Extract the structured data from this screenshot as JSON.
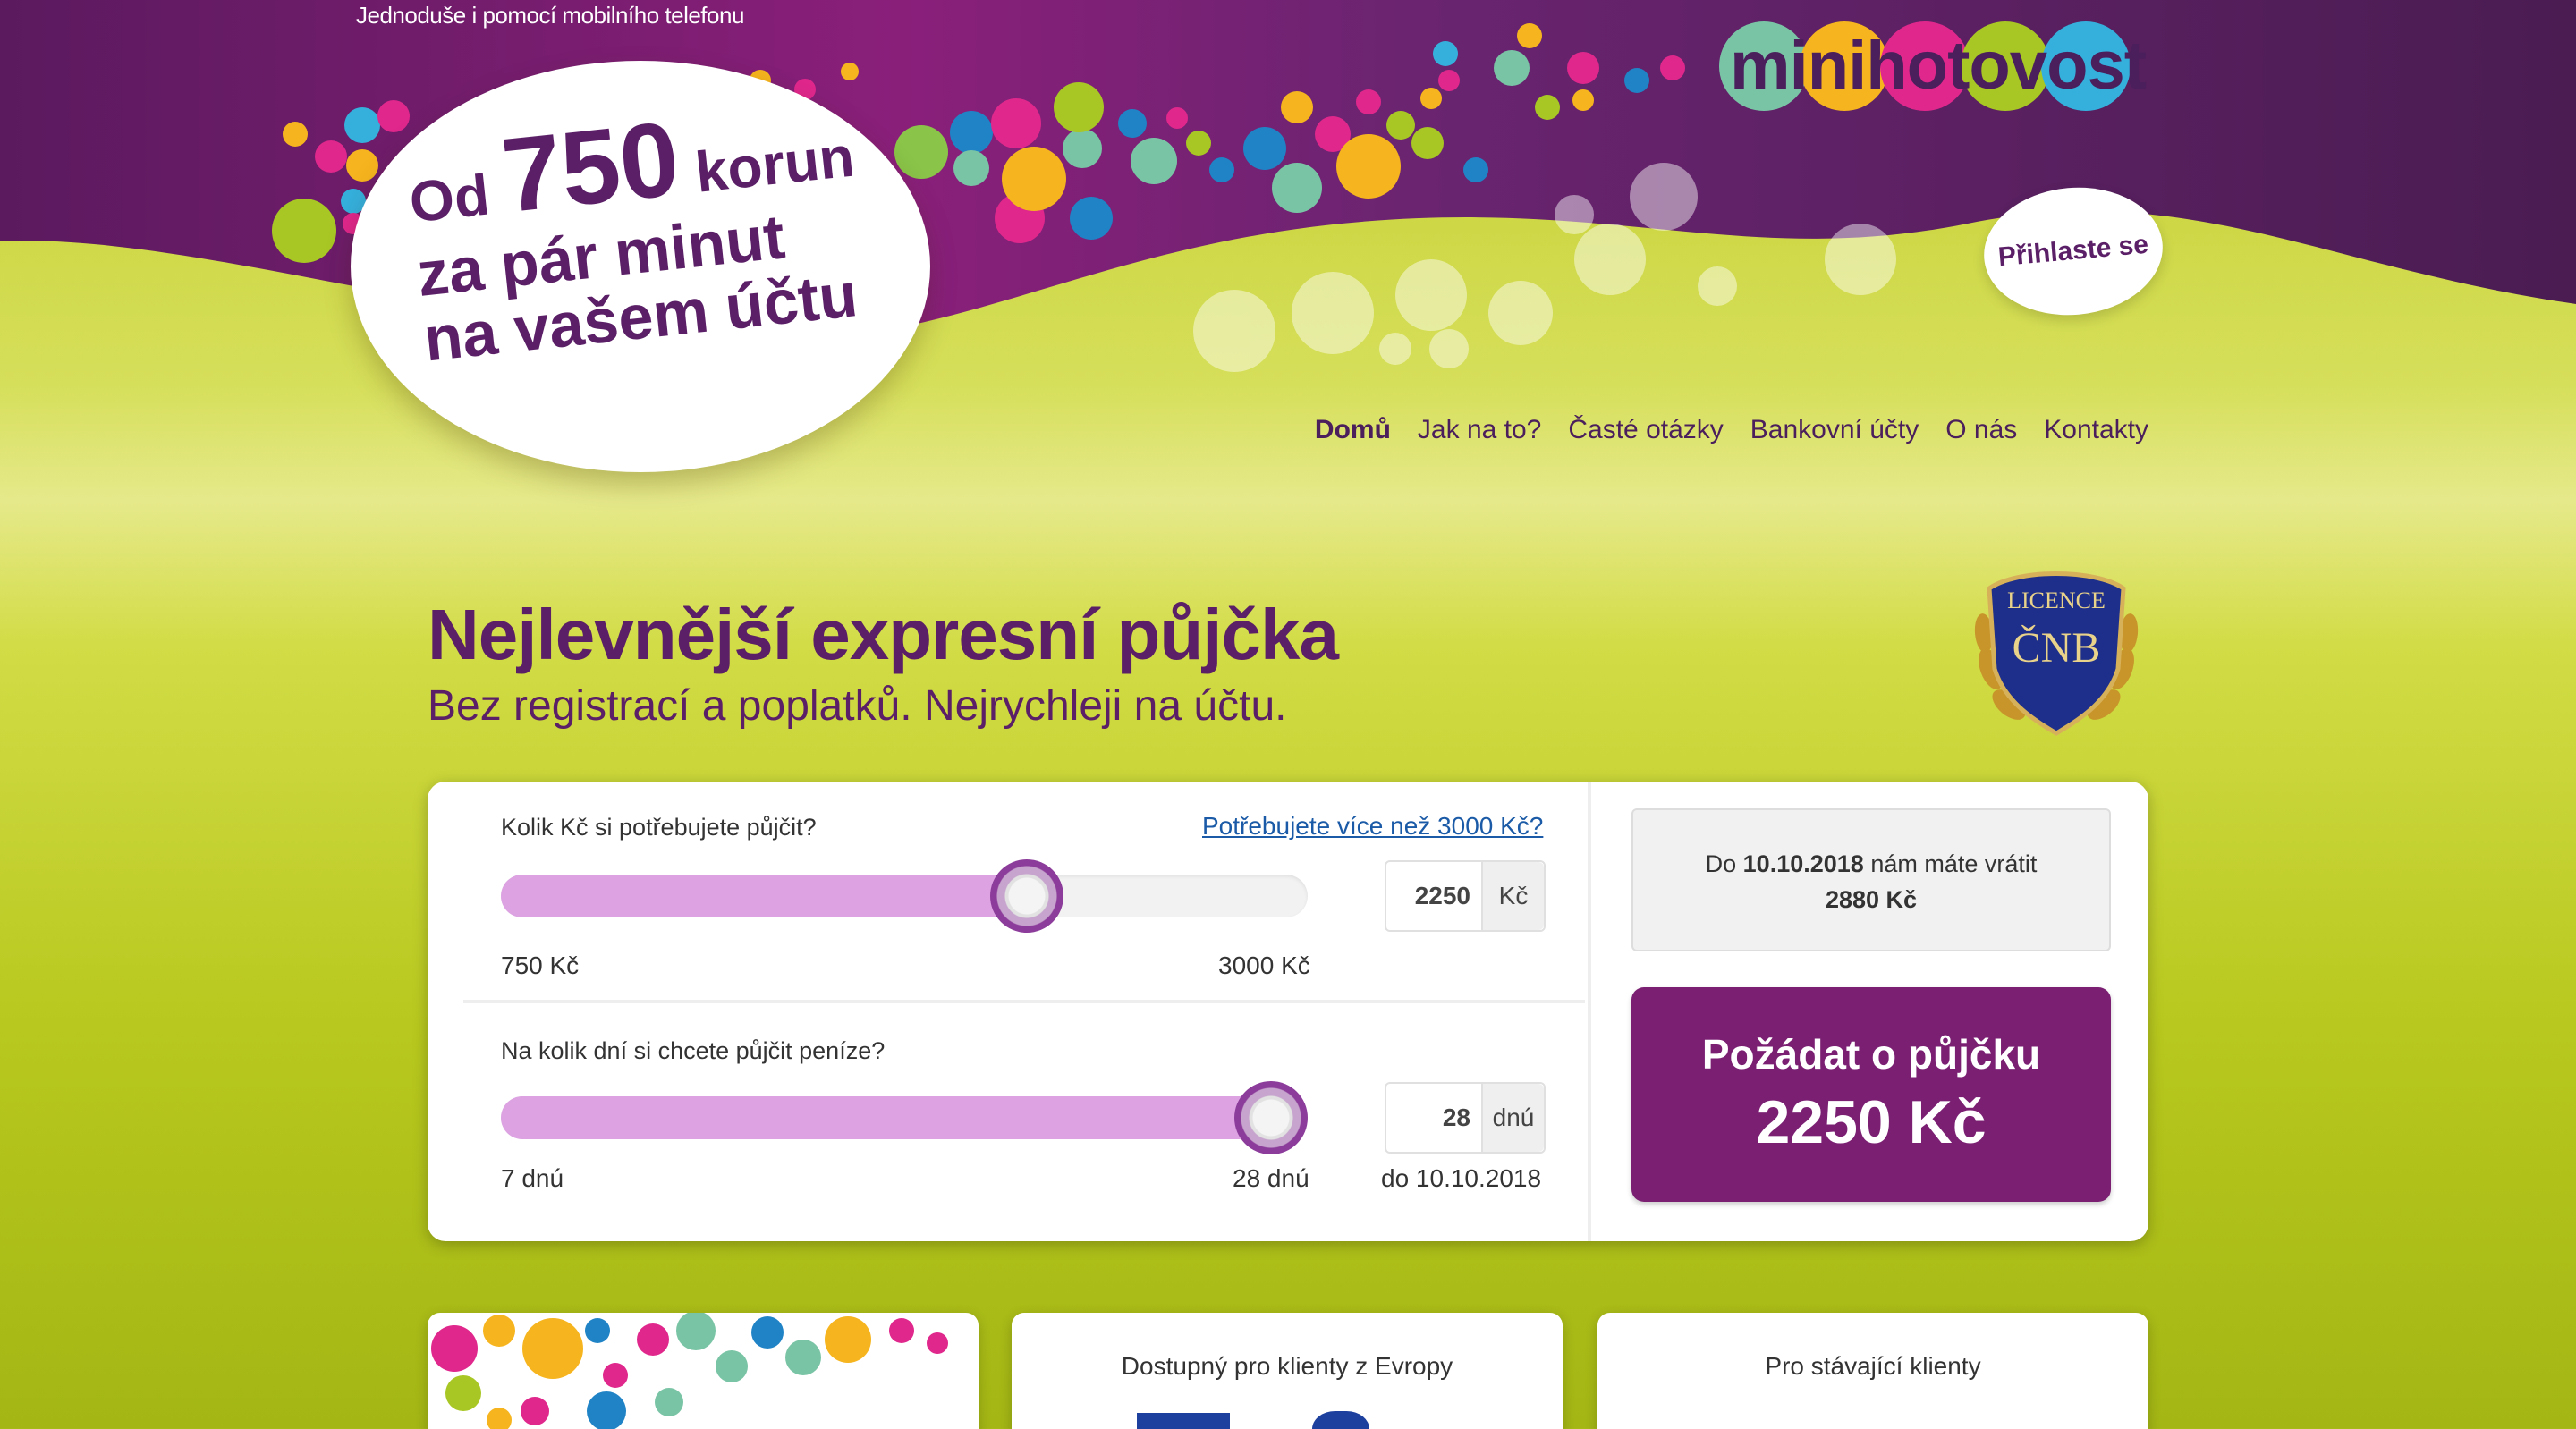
{
  "header": {
    "tagline": "Jednoduše i pomocí mobilního telefonu",
    "bubble": {
      "prefix": "Od",
      "amount": "750",
      "suffix": "korun",
      "line2": "za pár minut",
      "line3": "na vašem účtu"
    },
    "logo_text": "minihotovost",
    "login_label": "Přihlaste se"
  },
  "nav": {
    "items": [
      {
        "label": "Domů",
        "active": true
      },
      {
        "label": "Jak na to?"
      },
      {
        "label": "Časté otázky"
      },
      {
        "label": "Bankovní účty"
      },
      {
        "label": "O nás"
      },
      {
        "label": "Kontakty"
      }
    ]
  },
  "hero": {
    "title": "Nejlevnější expresní půjčka",
    "subtitle": "Bez registrací a poplatků. Nejrychleji na účtu."
  },
  "badge": {
    "line1": "LICENCE",
    "line2": "ČNB"
  },
  "calculator": {
    "amount": {
      "question": "Kolik Kč si potřebujete půjčit?",
      "more_link": "Potřebujete více než 3000 Kč?",
      "value": "2250",
      "unit": "Kč",
      "min_label": "750 Kč",
      "max_label": "3000 Kč",
      "fraction": 0.667
    },
    "days": {
      "question": "Na kolik dní si chcete půjčit peníze?",
      "value": "28",
      "unit": "dnú",
      "min_label": "7 dnú",
      "max_label": "28 dnú",
      "due_label": "do 10.10.2018",
      "fraction": 1.0
    },
    "summary": {
      "prefix": "Do",
      "date": "10.10.2018",
      "mid": "nám máte vrátit",
      "total": "2880 Kč"
    },
    "cta": {
      "label": "Požádat o půjčku",
      "amount": "2250 Kč"
    }
  },
  "cards": [
    {
      "title": ""
    },
    {
      "title": "Dostupný pro klienty z Evropy"
    },
    {
      "title": "Pro stávající klienty"
    }
  ],
  "colors": {
    "brand_purple": "#5a1f66",
    "cta": "#7a1f72",
    "slider_fill": "#dca2e2",
    "lime": "#c3ce2a"
  }
}
